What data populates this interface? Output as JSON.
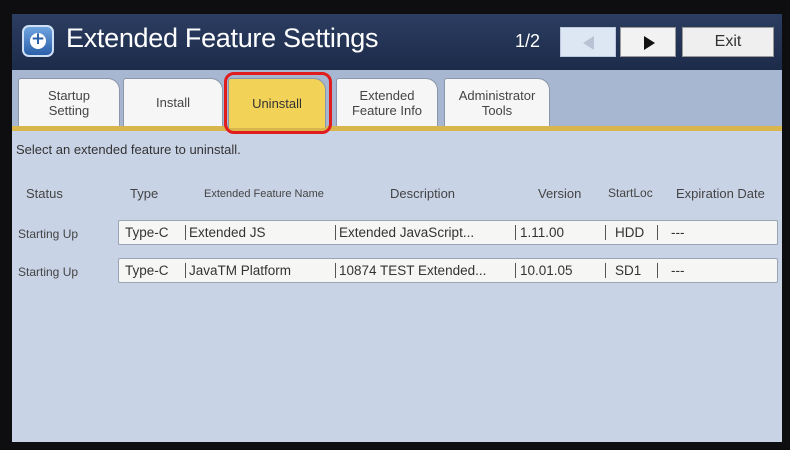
{
  "header": {
    "title": "Extended Feature Settings",
    "page_indicator": "1/2",
    "exit_label": "Exit"
  },
  "tabs": [
    {
      "label_line1": "Startup",
      "label_line2": "Setting",
      "active": false
    },
    {
      "label_line1": "Install",
      "label_line2": "",
      "active": false
    },
    {
      "label_line1": "Uninstall",
      "label_line2": "",
      "active": true
    },
    {
      "label_line1": "Extended",
      "label_line2": "Feature Info",
      "active": false
    },
    {
      "label_line1": "Administrator",
      "label_line2": "Tools",
      "active": false
    }
  ],
  "instruction": "Select an extended feature to uninstall.",
  "columns": {
    "status": "Status",
    "type": "Type",
    "name": "Extended Feature Name",
    "description": "Description",
    "version": "Version",
    "startloc": "StartLoc",
    "expiration": "Expiration Date"
  },
  "rows": [
    {
      "status": "Starting Up",
      "type": "Type-C",
      "name": "Extended JS",
      "description": "Extended JavaScript...",
      "version": "1.11.00",
      "startloc": "HDD",
      "expiration": "---"
    },
    {
      "status": "Starting Up",
      "type": "Type-C",
      "name": "JavaTM Platform",
      "description": "10874 TEST Extended...",
      "version": "10.01.05",
      "startloc": "SD1",
      "expiration": "---"
    }
  ],
  "colors": {
    "title_bar": "#23345a",
    "active_tab": "#f3d357",
    "highlight": "#e01c1c",
    "background": "#c9d3e6"
  }
}
